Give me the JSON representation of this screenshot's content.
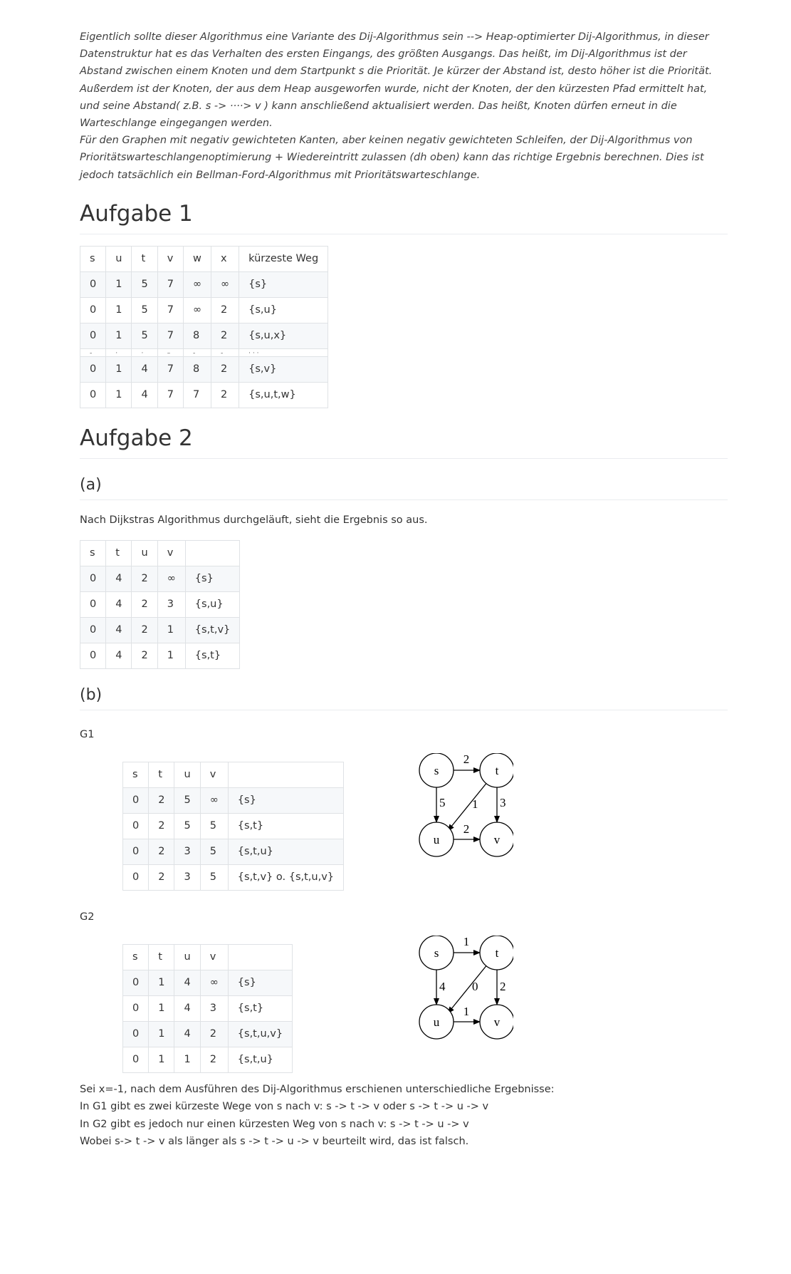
{
  "intro": {
    "paragraph1": "Eigentlich sollte dieser Algorithmus eine Variante des Dij-Algorithmus sein --> Heap-optimierter Dij-Algorithmus, in dieser Datenstruktur hat es das Verhalten des ersten Eingangs, des größten Ausgangs. Das heißt, im Dij-Algorithmus ist der Abstand zwischen einem Knoten und dem Startpunkt s die Priorität. Je kürzer der Abstand ist, desto höher ist die Priorität.",
    "paragraph2": "Außerdem ist der Knoten, der aus dem Heap ausgeworfen wurde, nicht der Knoten, der den kürzesten Pfad ermittelt hat, und seine Abstand( z.B. s -> ····> v ) kann anschließend aktualisiert werden. Das heißt, Knoten dürfen erneut in die Warteschlange eingegangen werden.",
    "paragraph3": "Für den Graphen mit negativ gewichteten Kanten, aber keinen negativ gewichteten Schleifen, der Dij-Algorithmus von Prioritätswarteschlangenoptimierung + Wiedereintritt zulassen (dh oben) kann das richtige Ergebnis berechnen. Dies ist jedoch tatsächlich ein Bellman-Ford-Algorithmus mit Prioritätswarteschlange."
  },
  "aufgabe1": {
    "title": "Aufgabe 1",
    "table": {
      "headers": [
        "s",
        "u",
        "t",
        "v",
        "w",
        "x",
        "kürzeste Weg"
      ],
      "rows": [
        [
          "0",
          "1",
          "5",
          "7",
          "∞",
          "∞",
          "{s}"
        ],
        [
          "0",
          "1",
          "5",
          "7",
          "∞",
          "2",
          "{s,u}"
        ],
        [
          "0",
          "1",
          "5",
          "7",
          "8",
          "2",
          "{s,u,x}"
        ]
      ],
      "partial_row": [
        "-",
        "·",
        "·",
        "–",
        "-",
        "-",
        "· · ·"
      ],
      "rows_after": [
        [
          "0",
          "1",
          "4",
          "7",
          "8",
          "2",
          "{s,v}"
        ],
        [
          "0",
          "1",
          "4",
          "7",
          "7",
          "2",
          "{s,u,t,w}"
        ]
      ]
    }
  },
  "aufgabe2": {
    "title": "Aufgabe 2",
    "a": {
      "title": "(a)",
      "text": "Nach Dijkstras Algorithmus durchgeläuft, sieht die Ergebnis so aus.",
      "table": {
        "headers": [
          "s",
          "t",
          "u",
          "v",
          ""
        ],
        "rows": [
          [
            "0",
            "4",
            "2",
            "∞",
            "{s}"
          ],
          [
            "0",
            "4",
            "2",
            "3",
            "{s,u}"
          ],
          [
            "0",
            "4",
            "2",
            "1",
            "{s,t,v}"
          ],
          [
            "0",
            "4",
            "2",
            "1",
            "{s,t}"
          ]
        ]
      }
    },
    "b": {
      "title": "(b)",
      "g1": {
        "label": "G1",
        "table": {
          "headers": [
            "s",
            "t",
            "u",
            "v",
            ""
          ],
          "rows": [
            [
              "0",
              "2",
              "5",
              "∞",
              "{s}"
            ],
            [
              "0",
              "2",
              "5",
              "5",
              "{s,t}"
            ],
            [
              "0",
              "2",
              "3",
              "5",
              "{s,t,u}"
            ],
            [
              "0",
              "2",
              "3",
              "5",
              "{s,t,v} o. {s,t,u,v}"
            ]
          ]
        },
        "graph": {
          "nodes": [
            "s",
            "t",
            "u",
            "v"
          ],
          "weights": {
            "s_t": "2",
            "s_u": "5",
            "t_u": "1",
            "t_v": "3",
            "u_v": "2"
          }
        }
      },
      "g2": {
        "label": "G2",
        "table": {
          "headers": [
            "s",
            "t",
            "u",
            "v",
            ""
          ],
          "rows": [
            [
              "0",
              "1",
              "4",
              "∞",
              "{s}"
            ],
            [
              "0",
              "1",
              "4",
              "3",
              "{s,t}"
            ],
            [
              "0",
              "1",
              "4",
              "2",
              "{s,t,u,v}"
            ],
            [
              "0",
              "1",
              "1",
              "2",
              "{s,t,u}"
            ]
          ]
        },
        "graph": {
          "nodes": [
            "s",
            "t",
            "u",
            "v"
          ],
          "weights": {
            "s_t": "1",
            "s_u": "4",
            "t_u": "0",
            "t_v": "2",
            "u_v": "1"
          }
        }
      },
      "conclusion": [
        "Sei x=-1, nach dem Ausführen des Dij-Algorithmus erschienen unterschiedliche Ergebnisse:",
        "In G1 gibt es zwei kürzeste Wege von s nach v: s -> t -> v oder s -> t -> u -> v",
        "In G2 gibt es jedoch nur einen kürzesten Weg von s nach v: s -> t -> u -> v",
        "Wobei s-> t -> v als länger als s -> t -> u -> v beurteilt wird, das ist falsch."
      ]
    }
  }
}
